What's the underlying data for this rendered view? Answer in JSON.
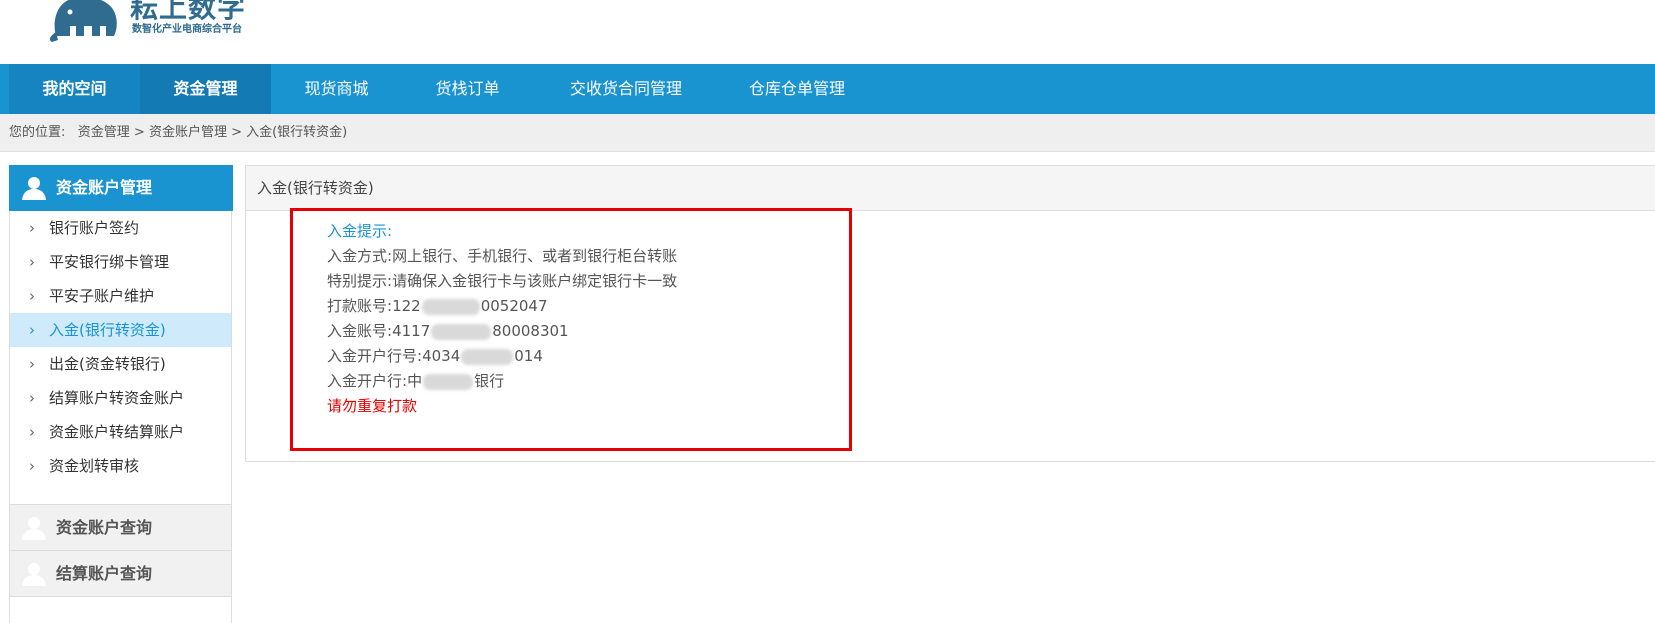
{
  "logo": {
    "title": "耘上数字",
    "subtitle": "数智化产业电商综合平台"
  },
  "nav": {
    "items": [
      {
        "label": "我的空间"
      },
      {
        "label": "资金管理"
      },
      {
        "label": "现货商城"
      },
      {
        "label": "货栈订单"
      },
      {
        "label": "交收货合同管理"
      },
      {
        "label": "仓库仓单管理"
      }
    ]
  },
  "breadcrumb": {
    "prefix": "您的位置:",
    "path": "资金管理 > 资金账户管理 > 入金(银行转资金)"
  },
  "sidebar": {
    "header": "资金账户管理",
    "items": [
      {
        "label": "银行账户签约"
      },
      {
        "label": "平安银行绑卡管理"
      },
      {
        "label": "平安子账户维护"
      },
      {
        "label": "入金(银行转资金)"
      },
      {
        "label": "出金(资金转银行)"
      },
      {
        "label": "结算账户转资金账户"
      },
      {
        "label": "资金账户转结算账户"
      },
      {
        "label": "资金划转审核"
      }
    ],
    "groups": [
      {
        "label": "资金账户查询"
      },
      {
        "label": "结算账户查询"
      }
    ]
  },
  "main": {
    "title": "入金(银行转资金)",
    "notice": {
      "tip_label": "入金提示:",
      "method_label": "入金方式:",
      "method_value": "网上银行、手机银行、或者到银行柜台转账",
      "special_label": "特别提示:",
      "special_value": "请确保入金银行卡与该账户绑定银行卡一致",
      "pay_account_label": "打款账号:",
      "pay_account_head": "122",
      "pay_account_tail": "0052047",
      "in_account_label": "入金账号:",
      "in_account_head": "4117",
      "in_account_tail": "8000830​1",
      "bank_no_label": "入金开户行号:",
      "bank_no_head": "4034",
      "bank_no_tail": "014",
      "bank_label": "入金开户行:",
      "bank_head": "中",
      "bank_tail": "银行",
      "warning": "请勿重复打款"
    }
  },
  "colors": {
    "primary": "#1a93d1",
    "warning": "#e60000"
  }
}
